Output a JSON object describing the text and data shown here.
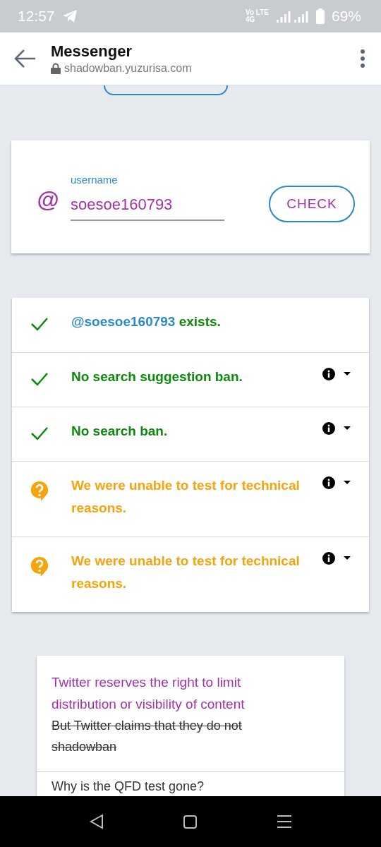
{
  "status_bar": {
    "time": "12:57",
    "network": "Vo LTE 4G",
    "battery": "69%"
  },
  "app_bar": {
    "title": "Messenger",
    "url": "shadowban.yuzurisa.com"
  },
  "search_form": {
    "label": "username",
    "value": "soesoe160793",
    "at_sign": "@",
    "button": "CHECK"
  },
  "results": [
    {
      "kind": "ok",
      "handle": "@soesoe160793",
      "text": "exists.",
      "has_info": false
    },
    {
      "kind": "ok",
      "text": "No search suggestion ban.",
      "has_info": true
    },
    {
      "kind": "ok",
      "text": "No search ban.",
      "has_info": true
    },
    {
      "kind": "unknown",
      "text": "We were unable to test for technical reasons.",
      "has_info": true
    },
    {
      "kind": "unknown",
      "text": "We were unable to test for technical reasons.",
      "has_info": true
    }
  ],
  "info_card": {
    "headline": "Twitter reserves the right to limit distribution or visibility of content",
    "struck_text": "But Twitter claims that they do not shadowban",
    "question": "Why is the QFD test gone?"
  }
}
